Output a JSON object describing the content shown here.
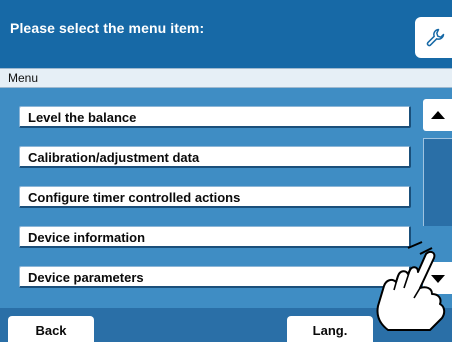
{
  "header": {
    "title": "Please select the menu item:",
    "settings_icon": "wrench-icon"
  },
  "menu_bar": {
    "label": "Menu"
  },
  "menu_items": [
    {
      "label": "Level the balance"
    },
    {
      "label": "Calibration/adjustment data"
    },
    {
      "label": "Configure timer controlled actions"
    },
    {
      "label": "Device information"
    },
    {
      "label": "Device parameters"
    }
  ],
  "scrollbar": {
    "up_icon": "triangle-up-icon",
    "down_icon": "triangle-down-icon"
  },
  "footer": {
    "back_label": "Back",
    "lang_label": "Lang."
  },
  "overlay": {
    "pointer_icon": "pointing-hand-icon"
  },
  "colors": {
    "header_blue": "#1769a6",
    "panel_blue": "#3f8dc4",
    "footer_blue": "#2a6fa7",
    "menu_bar_bg": "#e6eff6"
  }
}
